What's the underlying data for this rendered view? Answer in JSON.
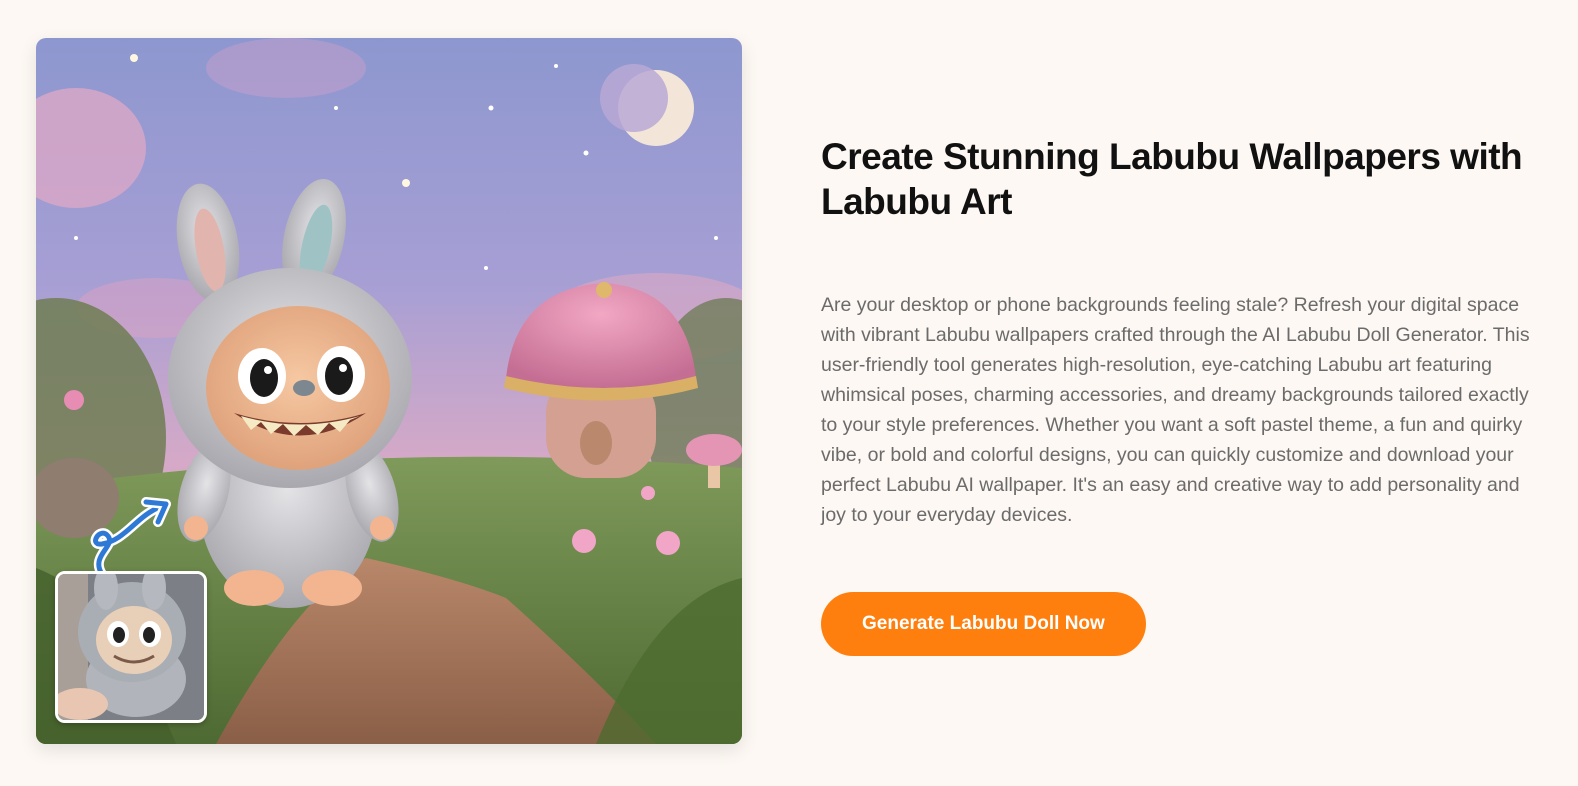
{
  "section": {
    "title": "Create Stunning Labubu Wallpapers with Labubu Art",
    "description": "Are your desktop or phone backgrounds feeling stale? Refresh your digital space with vibrant Labubu wallpapers crafted through the AI Labubu Doll Generator. This user-friendly tool generates high-resolution, eye-catching Labubu art featuring whimsical poses, charming accessories, and dreamy backgrounds tailored exactly to your style preferences. Whether you want a soft pastel theme, a fun and quirky vibe, or bold and colorful designs, you can quickly customize and download your perfect Labubu AI wallpaper. It's an easy and creative way to add personality and joy to your everyday devices.",
    "cta_label": "Generate Labubu Doll Now"
  },
  "colors": {
    "background": "#fdf8f3",
    "accent": "#ff7f0e",
    "title": "#111111",
    "body_text": "#6b6b6b"
  },
  "media": {
    "main_image_icon": "labubu-wallpaper-illustration",
    "thumbnail_icon": "labubu-doll-photo",
    "arrow_icon": "curly-arrow-icon"
  }
}
